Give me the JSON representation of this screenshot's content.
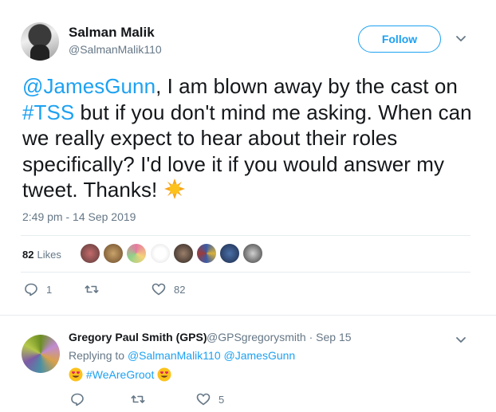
{
  "tweet": {
    "author_name": "Salman Malik",
    "author_handle": "@SalmanMalik110",
    "follow_label": "Follow",
    "text_link1": "@JamesGunn",
    "text_part1": ", I am blown away by the cast on ",
    "text_link2": "#TSS",
    "text_part2": " but if you don't mind me asking. When can we really expect to hear about their roles specifically? I'd love it if you would answer my tweet. Thanks!",
    "emoji": "sun-emoji",
    "timestamp": "2:49 pm - 14 Sep 2019",
    "likes_count": "82",
    "likes_label": "Likes",
    "reply_count": "1",
    "retweet_count": "",
    "like_count": "82"
  },
  "reply": {
    "author_name": "Gregory Paul Smith (GPS)",
    "author_handle": "@GPSgregorysmith",
    "separator": "·",
    "date": "Sep 15",
    "replying_to_label": "Replying to",
    "replying_to_1": "@SalmanMalik110",
    "replying_to_2": "@JamesGunn",
    "hashtag": "#WeAreGroot",
    "emoji": "heart-eyes-emoji",
    "reply_count": "",
    "retweet_count": "",
    "like_count": "5"
  },
  "colors": {
    "accent": "#1da1f2",
    "muted": "#657786",
    "text": "#14171a",
    "divider": "#e6ecf0"
  },
  "icons": [
    "reply-icon",
    "retweet-icon",
    "like-icon",
    "chevron-down-icon"
  ]
}
